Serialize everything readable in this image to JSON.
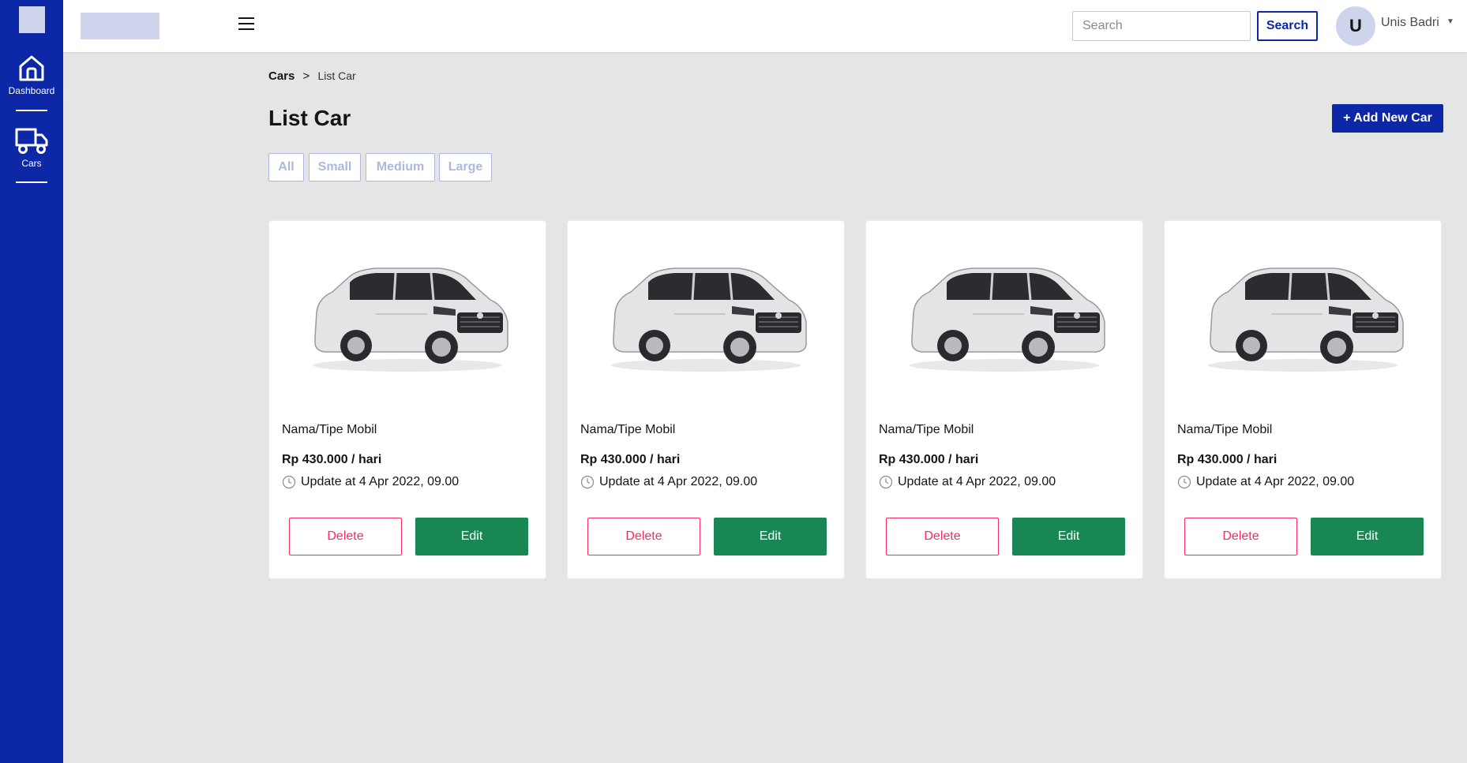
{
  "sidebar": {
    "items": [
      {
        "label": "Dashboard",
        "icon": "home-icon"
      },
      {
        "label": "Cars",
        "icon": "truck-icon"
      }
    ]
  },
  "header": {
    "search_placeholder": "Search",
    "search_button": "Search",
    "avatar_initial": "U",
    "user_name": "Unis Badri"
  },
  "breadcrumb": {
    "root": "Cars",
    "separator": ">",
    "current": "List Car"
  },
  "page": {
    "title": "List Car",
    "add_button": "+ Add New Car"
  },
  "filters": [
    "All",
    "Small",
    "Medium",
    "Large"
  ],
  "cars": [
    {
      "name": "Nama/Tipe Mobil",
      "price": "Rp 430.000 / hari",
      "updated": "Update at 4 Apr 2022, 09.00",
      "delete_label": "Delete",
      "edit_label": "Edit"
    },
    {
      "name": "Nama/Tipe Mobil",
      "price": "Rp 430.000 / hari",
      "updated": "Update at 4 Apr 2022, 09.00",
      "delete_label": "Delete",
      "edit_label": "Edit"
    },
    {
      "name": "Nama/Tipe Mobil",
      "price": "Rp 430.000 / hari",
      "updated": "Update at 4 Apr 2022, 09.00",
      "delete_label": "Delete",
      "edit_label": "Edit"
    },
    {
      "name": "Nama/Tipe Mobil",
      "price": "Rp 430.000 / hari",
      "updated": "Update at 4 Apr 2022, 09.00",
      "delete_label": "Delete",
      "edit_label": "Edit"
    }
  ],
  "colors": {
    "primary": "#0d28a6",
    "sidebar": "#0d28a6",
    "placeholder_block": "#cfd4ed",
    "delete": "#fa2c5a",
    "edit": "#198754",
    "filter": "#aeb7e1",
    "background": "#e5e5e5"
  }
}
